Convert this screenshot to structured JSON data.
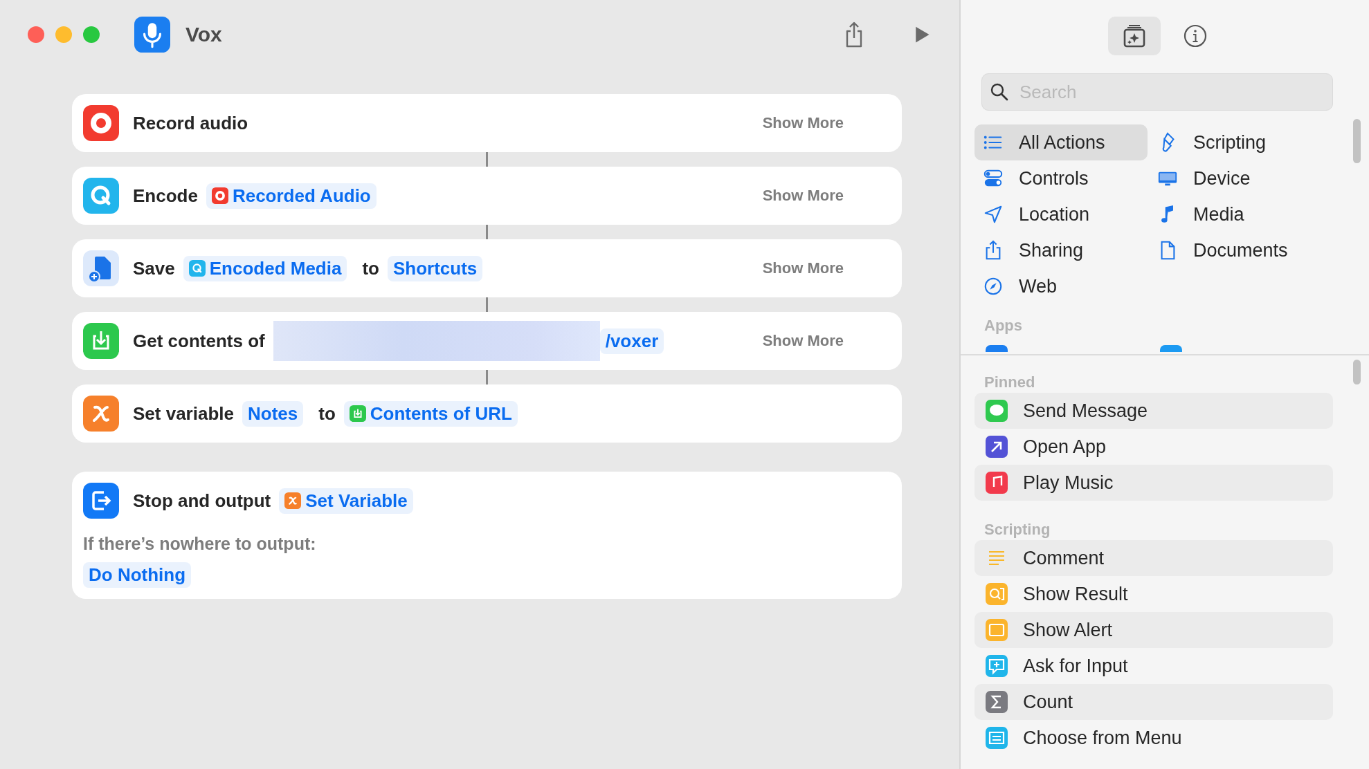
{
  "window": {
    "title": "Vox"
  },
  "actions": [
    {
      "kind": "record",
      "show_more": "Show More",
      "parts": [
        {
          "kind": "label",
          "text": "Record audio"
        }
      ]
    },
    {
      "kind": "encode",
      "show_more": "Show More",
      "parts": [
        {
          "kind": "label",
          "text": "Encode"
        },
        {
          "kind": "record",
          "text": "Recorded Audio"
        }
      ]
    },
    {
      "kind": "save",
      "show_more": "Show More",
      "parts": [
        {
          "kind": "label",
          "text": "Save"
        },
        {
          "kind": "encode",
          "text": "Encoded Media"
        },
        {
          "kind": "label",
          "text": "to"
        },
        {
          "kind": "token",
          "text": "Shortcuts"
        }
      ]
    },
    {
      "kind": "download",
      "show_more": "Show More",
      "parts": [
        {
          "kind": "label",
          "text": "Get contents of"
        },
        {
          "kind": "redacted"
        },
        {
          "kind": "token",
          "text": "/voxer"
        }
      ]
    },
    {
      "kind": "variable",
      "parts": [
        {
          "kind": "label",
          "text": "Set variable"
        },
        {
          "kind": "token",
          "text": "Notes"
        },
        {
          "kind": "label",
          "text": "to"
        },
        {
          "kind": "download",
          "text": "Contents of URL"
        }
      ]
    },
    {
      "kind": "output",
      "parts": [
        {
          "kind": "label",
          "text": "Stop and output"
        },
        {
          "kind": "variable",
          "text": "Set Variable"
        }
      ],
      "note": "If there’s nowhere to output:",
      "fallback": "Do Nothing"
    }
  ],
  "sidebar": {
    "tabs": [
      {
        "kind": "library",
        "selected": true
      },
      {
        "kind": "info",
        "selected": false
      }
    ],
    "search": {
      "placeholder": "Search"
    },
    "categories": [
      {
        "kind": "list",
        "label": "All Actions",
        "selected": true
      },
      {
        "kind": "scripting",
        "label": "Scripting",
        "selected": false
      },
      {
        "kind": "controls",
        "label": "Controls",
        "selected": false
      },
      {
        "kind": "device",
        "label": "Device",
        "selected": false
      },
      {
        "kind": "location",
        "label": "Location",
        "selected": false
      },
      {
        "kind": "media",
        "label": "Media",
        "selected": false
      },
      {
        "kind": "sharing",
        "label": "Sharing",
        "selected": false
      },
      {
        "kind": "documents",
        "label": "Documents",
        "selected": false
      },
      {
        "kind": "web",
        "label": "Web",
        "selected": false
      }
    ],
    "apps_header": "Apps",
    "sections": [
      {
        "title": "Pinned",
        "items": [
          {
            "kind": "message",
            "label": "Send Message"
          },
          {
            "kind": "openapp",
            "label": "Open App"
          },
          {
            "kind": "music",
            "label": "Play Music"
          }
        ]
      },
      {
        "title": "Scripting",
        "items": [
          {
            "kind": "comment",
            "label": "Comment"
          },
          {
            "kind": "result",
            "label": "Show Result"
          },
          {
            "kind": "alert",
            "label": "Show Alert"
          },
          {
            "kind": "input",
            "label": "Ask for Input"
          },
          {
            "kind": "count",
            "label": "Count"
          },
          {
            "kind": "menu",
            "label": "Choose from Menu"
          }
        ]
      }
    ]
  }
}
